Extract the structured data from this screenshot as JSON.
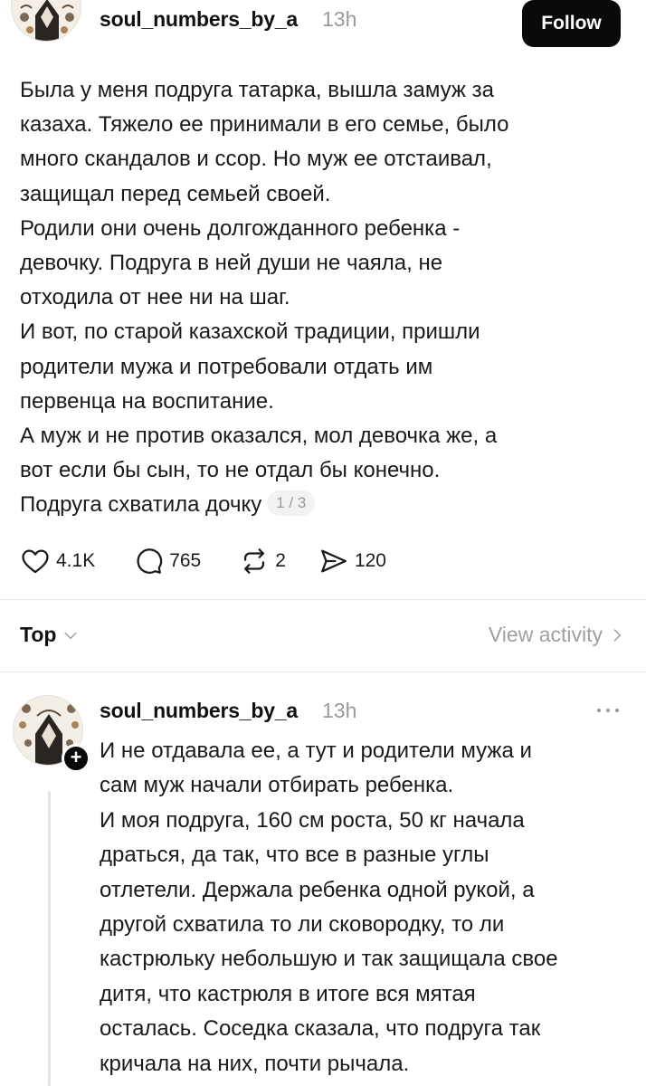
{
  "post": {
    "username": "soul_numbers_by_a",
    "time": "13h",
    "follow_label": "Follow",
    "avatar_icon": "ornamental-avatar-icon",
    "lines": [
      "Была у меня подруга татарка, вышла замуж за",
      "казаха. Тяжело ее принимали в его семье, было",
      "много скандалов и ссор. Но муж ее отстаивал,",
      "защищал перед семьей своей.",
      "Родили они очень долгожданного ребенка -",
      "девочку. Подруга в ней души не чаяла, не",
      "отходила от нее ни на шаг.",
      "И вот, по старой казахской традиции, пришли",
      "родители мужа и потребовали отдать им",
      "первенца на воспитание.",
      "А муж и не против оказался, мол девочка же, а",
      "вот если бы сын, то не отдал бы конечно.",
      "Подруга схватила дочку"
    ],
    "pager": "1 / 3",
    "actions": {
      "likes": "4.1K",
      "replies": "765",
      "reposts": "2",
      "shares": "120",
      "icons": [
        "heart-icon",
        "comment-icon",
        "repost-icon",
        "share-icon"
      ]
    }
  },
  "sort": {
    "label": "Top",
    "view_activity": "View activity"
  },
  "reply": {
    "username": "soul_numbers_by_a",
    "time": "13h",
    "lines": [
      "И не отдавала ее, а тут и родители мужа и",
      "сам муж начали отбирать ребенка.",
      "И моя подруга, 160 см роста, 50 кг начала",
      "драться, да так, что все в разные углы",
      "отлетели. Держала ребенка одной рукой, а",
      "другой схватила то ли сковородку, то ли",
      "кастрюльку небольшую и так защищала свое",
      "дитя, что кастрюля в итоге вся мятая",
      "осталась. Соседка сказала, что подруга так",
      "кричала на них, почти рычала."
    ]
  },
  "colors": {
    "text": "#1a1a1a",
    "muted": "#9a9a9a",
    "button_bg": "#0a0a0a",
    "divider": "#e8e8e8"
  }
}
